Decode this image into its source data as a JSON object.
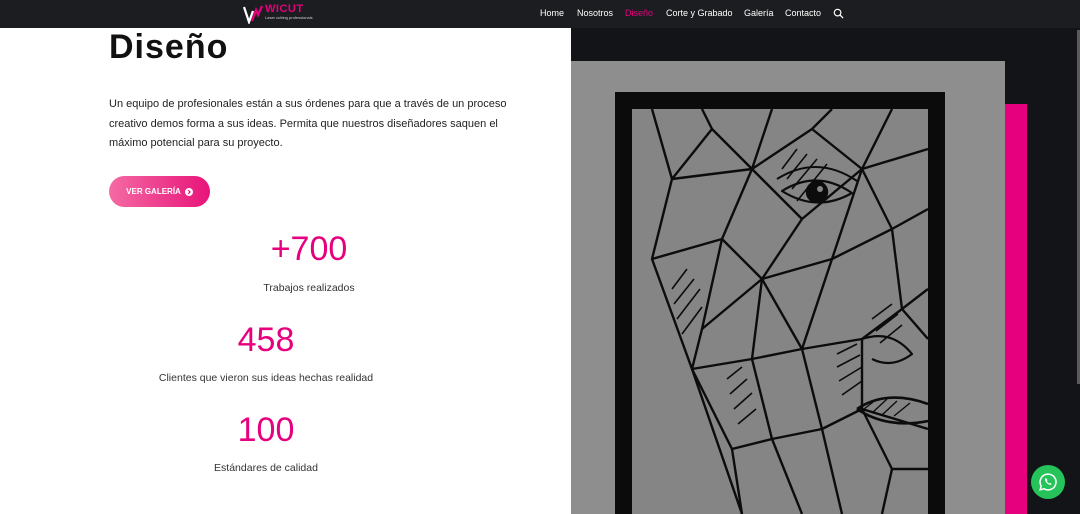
{
  "brand": {
    "name": "WICUT",
    "tagline": "Laser cutting professionals",
    "accent": "#e6007e"
  },
  "nav": {
    "items": [
      {
        "label": "Home"
      },
      {
        "label": "Nosotros"
      },
      {
        "label": "Diseño",
        "active": true
      },
      {
        "label": "Corte y Grabado"
      },
      {
        "label": "Galería"
      },
      {
        "label": "Contacto"
      }
    ],
    "search_icon": "search-icon"
  },
  "hero": {
    "title": "Diseño",
    "description": "Un equipo de profesionales están a sus órdenes para que a través de un proceso creativo demos forma a sus ideas. Permita que nuestros diseñadores saquen el máximo potencial para su proyecto.",
    "button_label": "VER GALERÍA",
    "button_icon": "arrow-circle-right-icon"
  },
  "stats": [
    {
      "value": "+700",
      "label": "Trabajos realizados"
    },
    {
      "value": "458",
      "label": "Clientes que vieron sus ideas hechas realidad"
    },
    {
      "value": "100",
      "label": "Estándares de calidad"
    }
  ],
  "chat": {
    "icon": "whatsapp-icon",
    "color": "#25c35a"
  }
}
